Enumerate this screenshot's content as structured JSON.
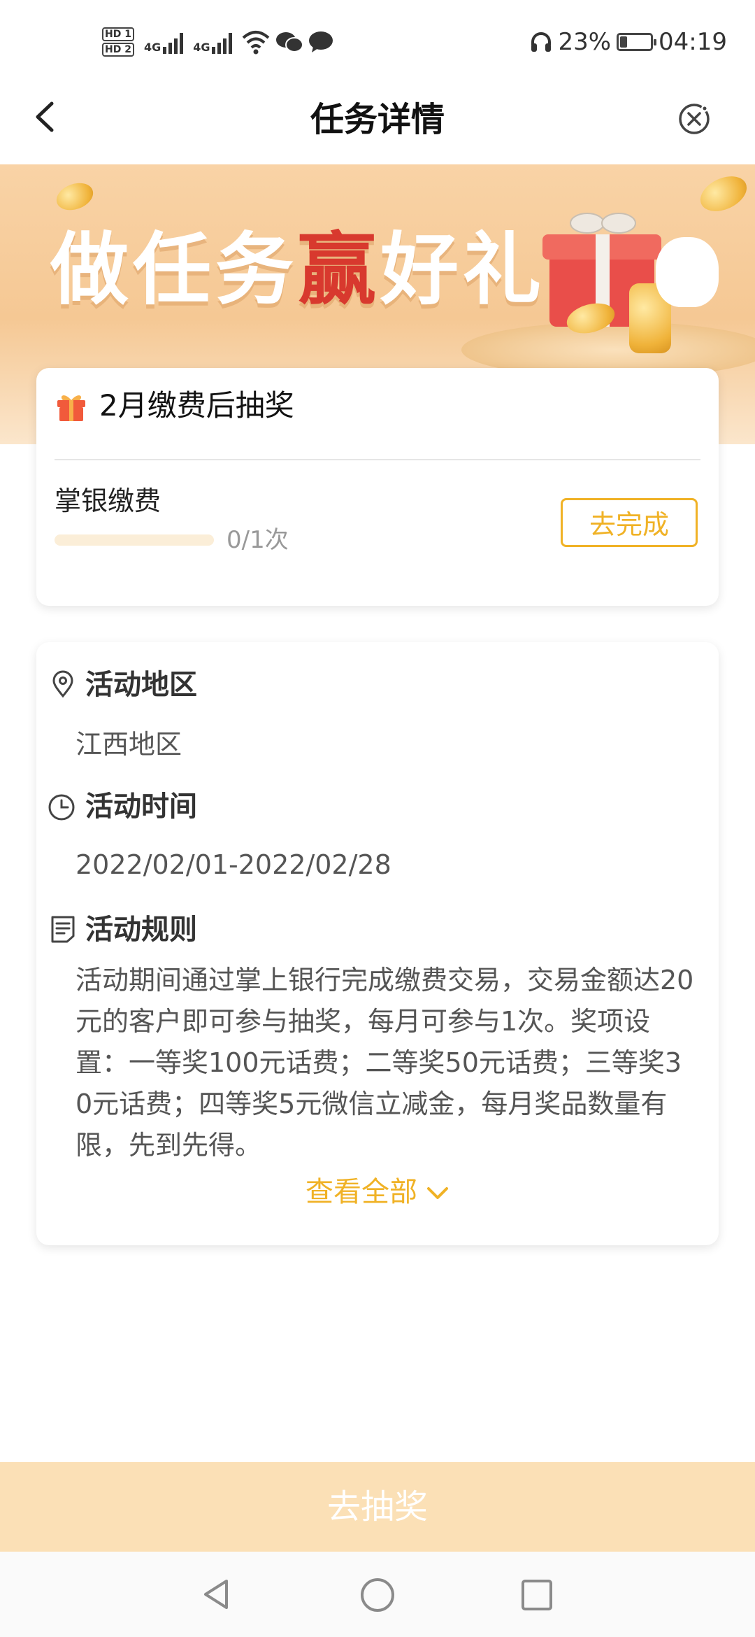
{
  "status_bar": {
    "sim1": "HD 1",
    "sim2": "HD 2",
    "net1": "4G",
    "net2": "4G",
    "battery_pct": "23%",
    "battery_level": 0.23,
    "time": "04:19",
    "icons": [
      "signal-icon",
      "wifi-icon",
      "wechat-icon",
      "message-icon",
      "headphones-icon",
      "battery-icon"
    ]
  },
  "header": {
    "title": "任务详情",
    "back_icon": "chevron-left-icon",
    "close_icon": "close-circle-icon"
  },
  "banner": {
    "text_part1": "做任务",
    "text_highlight": "赢",
    "text_part2": "好礼",
    "highlight_color": "#d8392e"
  },
  "task_card": {
    "title": "2月缴费后抽奖",
    "task_name": "掌银缴费",
    "progress_text": "0/1次",
    "progress_fraction": 0,
    "action_label": "去完成"
  },
  "info_card": {
    "region_title": "活动地区",
    "region_value": "江西地区",
    "time_title": "活动时间",
    "time_value": "2022/02/01-2022/02/28",
    "rules_title": "活动规则",
    "rules_text": "活动期间通过掌上银行完成缴费交易，交易金额达20元的客户即可参与抽奖，每月可参与1次。奖项设置：一等奖100元话费；二等奖50元话费；三等奖30元话费；四等奖5元微信立减金，每月奖品数量有限，先到先得。",
    "view_all_label": "查看全部"
  },
  "bottom": {
    "lottery_label": "去抽奖"
  },
  "colors": {
    "accent": "#f0b226",
    "banner_bg": "#f7cc99",
    "disabled_button": "#fbe0b6"
  }
}
